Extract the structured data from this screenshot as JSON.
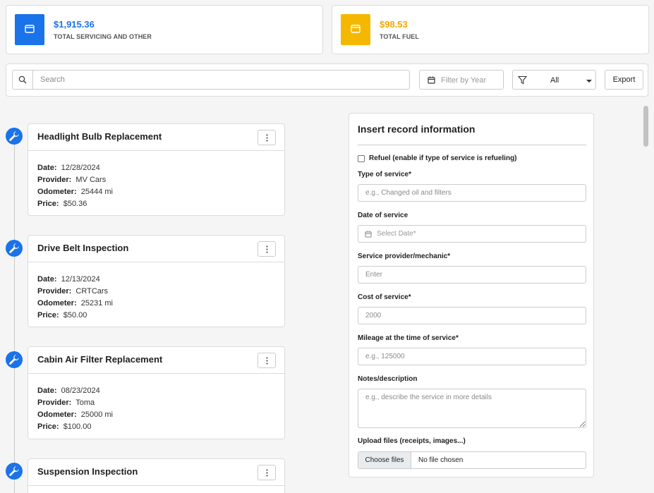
{
  "summary": {
    "servicing": {
      "amount": "$1,915.36",
      "label": "TOTAL SERVICING AND OTHER",
      "color": "#1a73e8"
    },
    "fuel": {
      "amount": "$98.53",
      "label": "TOTAL FUEL",
      "color": "#f5b800"
    }
  },
  "toolbar": {
    "search_placeholder": "Search",
    "year_placeholder": "Filter by Year",
    "filter_value": "All",
    "export_label": "Export"
  },
  "records": [
    {
      "title": "Headlight Bulb Replacement",
      "date_label": "Date:",
      "date": "12/28/2024",
      "provider_label": "Provider:",
      "provider": "MV Cars",
      "odometer_label": "Odometer:",
      "odometer": "25444 mi",
      "price_label": "Price:",
      "price": "$50.36"
    },
    {
      "title": "Drive Belt Inspection",
      "date_label": "Date:",
      "date": "12/13/2024",
      "provider_label": "Provider:",
      "provider": "CRTCars",
      "odometer_label": "Odometer:",
      "odometer": "25231 mi",
      "price_label": "Price:",
      "price": "$50.00"
    },
    {
      "title": "Cabin Air Filter Replacement",
      "date_label": "Date:",
      "date": "08/23/2024",
      "provider_label": "Provider:",
      "provider": "Toma",
      "odometer_label": "Odometer:",
      "odometer": "25000 mi",
      "price_label": "Price:",
      "price": "$100.00"
    },
    {
      "title": "Suspension Inspection"
    }
  ],
  "form": {
    "title": "Insert record information",
    "refuel_label": "Refuel (enable if type of service is refueling)",
    "type_label": "Type of service*",
    "type_placeholder": "e.g., Changed oil and filters",
    "date_label": "Date of service",
    "date_placeholder": "Select Date*",
    "provider_label": "Service provider/mechanic*",
    "provider_placeholder": "Enter",
    "cost_label": "Cost of service*",
    "cost_placeholder": "2000",
    "mileage_label": "Mileage at the time of service*",
    "mileage_placeholder": "e.g., 125000",
    "notes_label": "Notes/description",
    "notes_placeholder": "e.g., describe the service in more details",
    "upload_label": "Upload files (receipts, images...)",
    "choose_files_label": "Choose files",
    "no_file_label": "No file chosen"
  },
  "icons": {
    "summary": "wallet-icon",
    "search": "search-icon",
    "calendar": "calendar-icon",
    "filter": "filter-icon",
    "timeline": "wrench-icon",
    "menu": "kebab-menu-icon"
  }
}
